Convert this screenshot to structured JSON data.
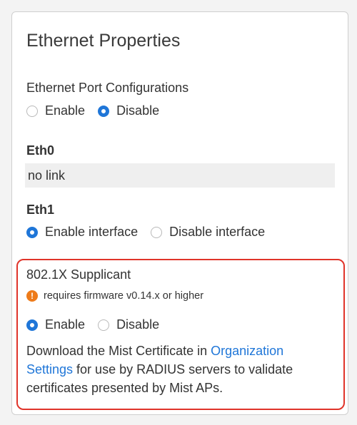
{
  "panel": {
    "title": "Ethernet Properties"
  },
  "port_config": {
    "label": "Ethernet Port Configurations",
    "options": [
      "Enable",
      "Disable"
    ],
    "selected": "Disable"
  },
  "eth0": {
    "label": "Eth0",
    "value": "no link"
  },
  "eth1": {
    "label": "Eth1",
    "options": [
      "Enable interface",
      "Disable interface"
    ],
    "selected": "Enable interface"
  },
  "supplicant": {
    "label": "802.1X Supplicant",
    "warning": "requires firmware v0.14.x or higher",
    "warning_icon": "!",
    "options": [
      "Enable",
      "Disable"
    ],
    "selected": "Enable",
    "desc_before": "Download the Mist Certificate in ",
    "link_text": "Organization Settings",
    "desc_after": " for use by RADIUS servers to validate certificates presented by Mist APs."
  },
  "colors": {
    "accent": "#1f76d8",
    "highlight_border": "#e0342a",
    "warning": "#ee7b1a"
  }
}
